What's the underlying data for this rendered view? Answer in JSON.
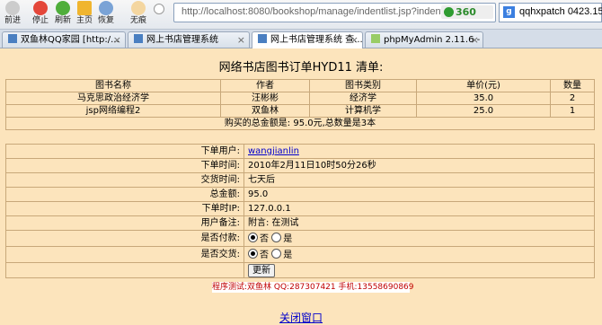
{
  "toolbar": {
    "back": "前进",
    "stop": "停止",
    "refresh": "刷新",
    "home": "主页",
    "restore": "恢复",
    "notrace": "无痕",
    "address": "http://localhost:8080/bookshop/manage/indentlist.jsp?indent",
    "badge": "360",
    "search_text": "qqhxpatch 0423.15"
  },
  "tabs": [
    {
      "label": "双鱼林QQ家园 [http:/..."
    },
    {
      "label": "网上书店管理系统"
    },
    {
      "label": "网上书店管理系统  查..."
    },
    {
      "label": "phpMyAdmin 2.11.6 - L..."
    }
  ],
  "page": {
    "title": "网络书店图书订单HYD11 清单:",
    "books_header": [
      "图书名称",
      "作者",
      "图书类别",
      "单价(元)",
      "数量"
    ],
    "books": [
      [
        "马克思政治经济学",
        "汪彬彬",
        "经济学",
        "35.0",
        "2"
      ],
      [
        "jsp网络编程2",
        "双鱼林",
        "计算机学",
        "25.0",
        "1"
      ]
    ],
    "total_text": "购买的总金额是: 95.0元,总数量是3本",
    "details": {
      "user_label": "下单用户:",
      "user_value": "wangjianlin",
      "time_label": "下单时间:",
      "time_value": "2010年2月11日10时50分26秒",
      "delivery_label": "交货时间:",
      "delivery_value": "七天后",
      "amount_label": "总金额:",
      "amount_value": "95.0",
      "ip_label": "下单时IP:",
      "ip_value": "127.0.0.1",
      "remark_label": "用户备注:",
      "remark_value": "附言: 在测试",
      "paid_label": "是否付款:",
      "delivered_label": "是否交货:",
      "no": "否",
      "yes": "是",
      "update_btn": "更新"
    },
    "tester": "程序测试:双鱼林 QQ:287307421 手机:13558690869",
    "close_link": "关闭窗口"
  }
}
